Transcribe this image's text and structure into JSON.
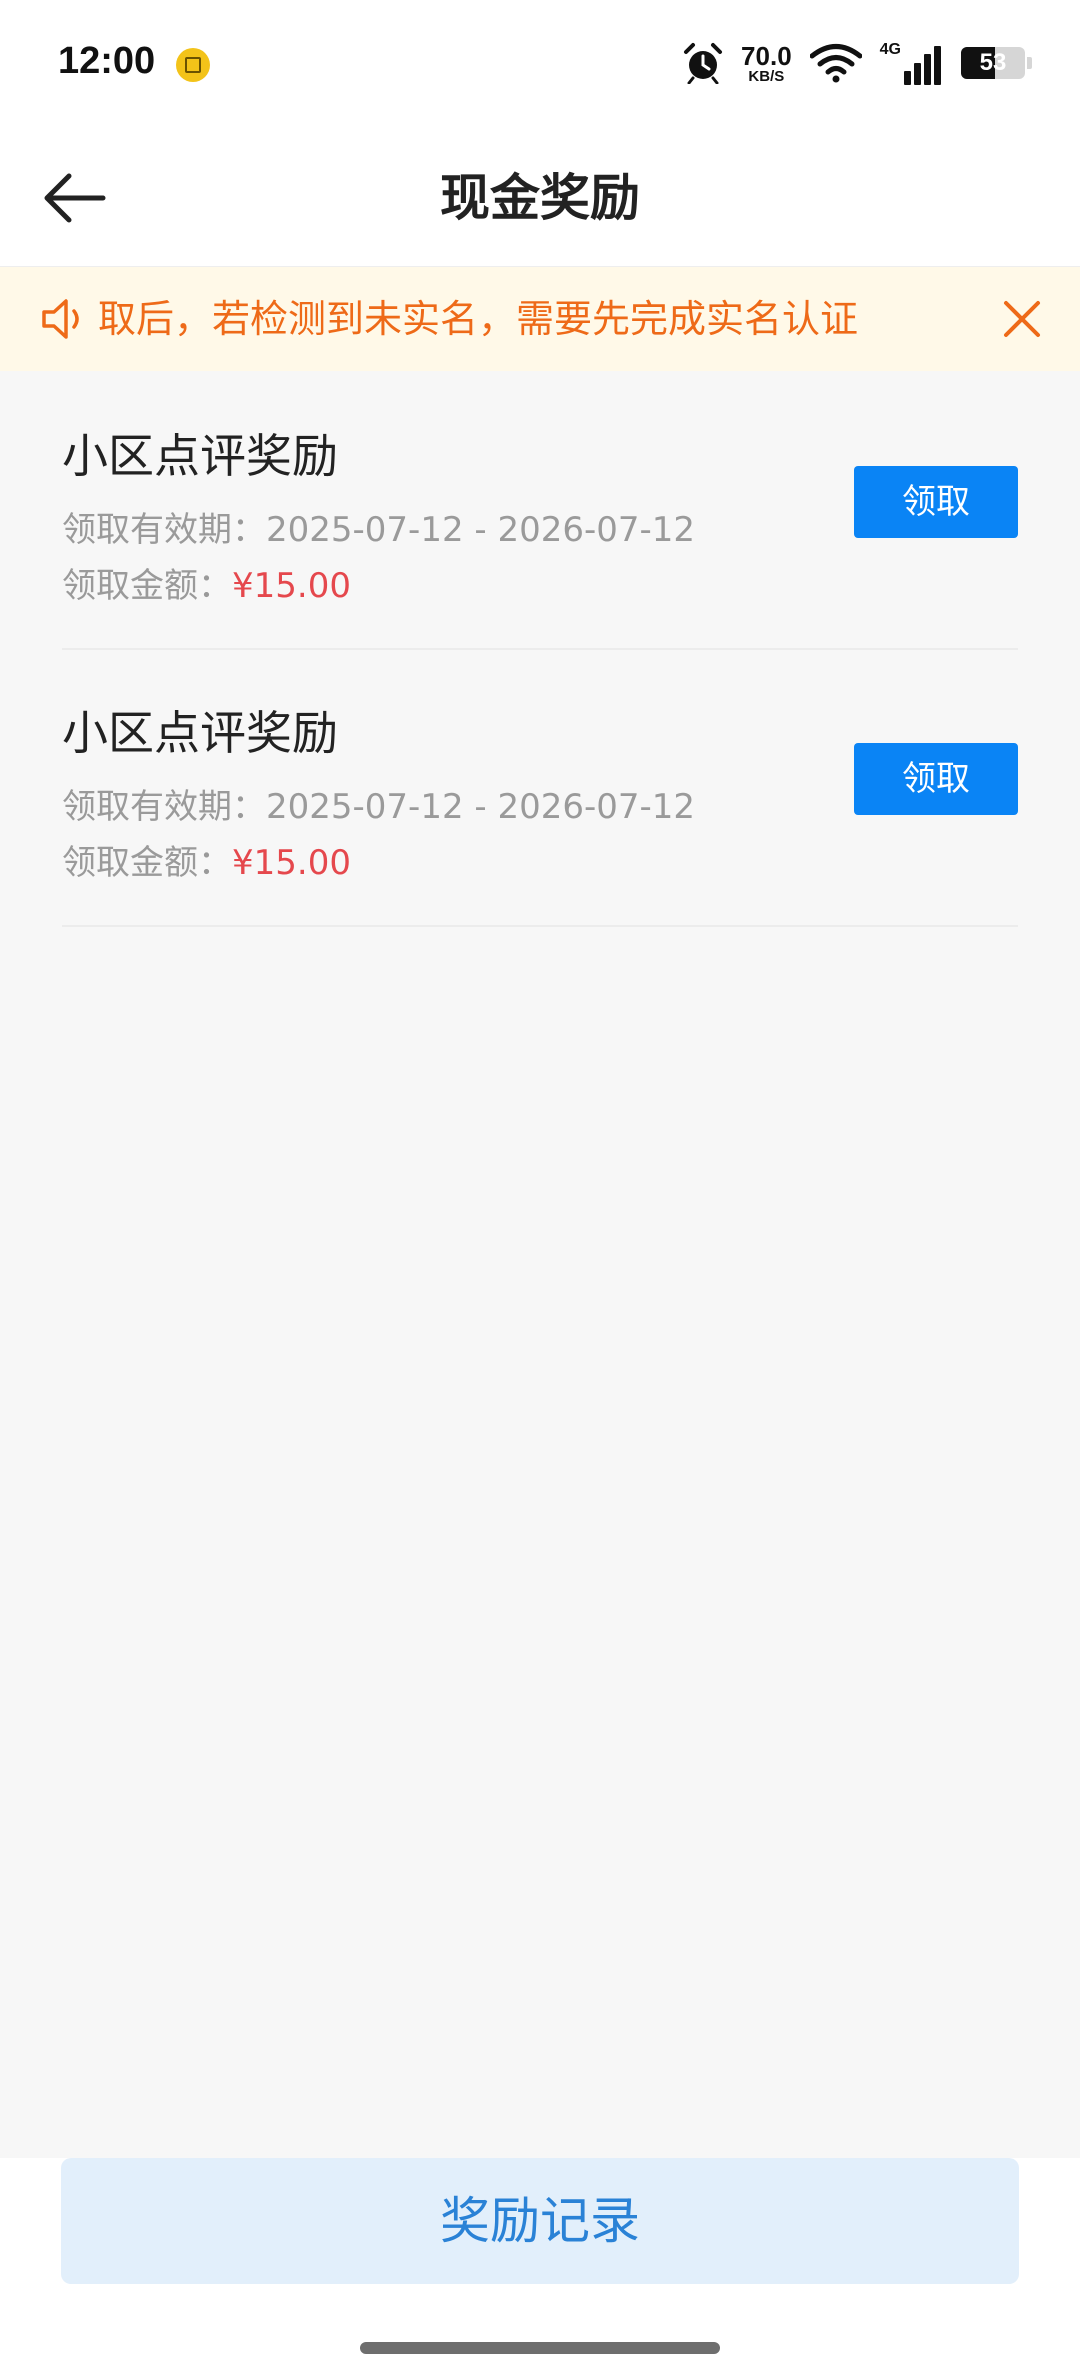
{
  "status_bar": {
    "time": "12:00",
    "net_speed_value": "70.0",
    "net_speed_unit": "KB/S",
    "network_type": "4G",
    "battery_level": "53",
    "battery_fraction": 0.53,
    "icons": [
      "app-notification-icon",
      "alarm-icon",
      "wifi-icon",
      "signal-icon",
      "battery-icon"
    ]
  },
  "nav": {
    "title": "现金奖励",
    "back_icon": "back-arrow-icon"
  },
  "notice": {
    "text": "领取后，若检测到未实名，需要先完成实名认证",
    "icon": "speaker-icon",
    "close_icon": "close-icon",
    "text_color": "#ee6a18",
    "background": "#fff9e8"
  },
  "rewards": [
    {
      "title": "小区点评奖励",
      "validity_label": "领取有效期：",
      "validity": "2025-07-12 - 2026-07-12",
      "amount_label": "领取金额：",
      "amount": "¥15.00",
      "button": "领取"
    },
    {
      "title": "小区点评奖励",
      "validity_label": "领取有效期：",
      "validity": "2025-07-12 - 2026-07-12",
      "amount_label": "领取金额：",
      "amount": "¥15.00",
      "button": "领取"
    }
  ],
  "footer": {
    "records_button": "奖励记录"
  },
  "colors": {
    "primary_button": "#0a84f5",
    "amount": "#e5484d",
    "records_button_bg": "#e2effb",
    "records_button_text": "#2a82d6"
  }
}
